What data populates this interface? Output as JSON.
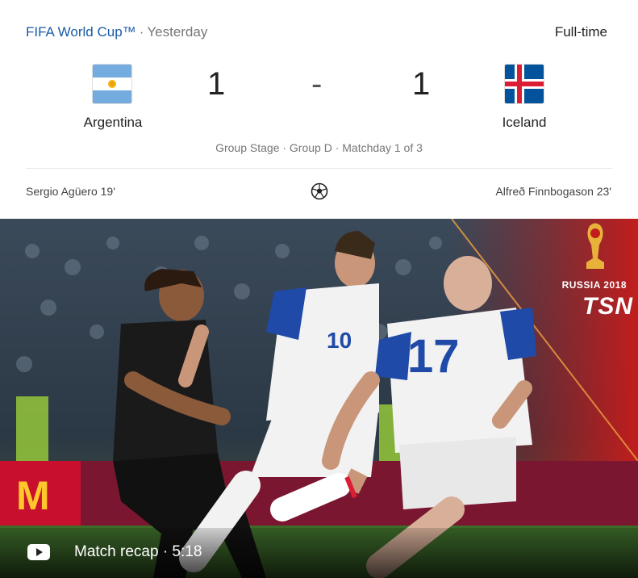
{
  "header": {
    "competition": "FIFA World Cup™",
    "separator": "·",
    "date": "Yesterday",
    "status": "Full-time"
  },
  "match": {
    "home": {
      "name": "Argentina",
      "score": "1",
      "flag_icon": "argentina-flag-icon"
    },
    "away": {
      "name": "Iceland",
      "score": "1",
      "flag_icon": "iceland-flag-icon"
    },
    "dash": "-",
    "stage": "Group Stage · Group D · Matchday 1 of 3"
  },
  "scorers": {
    "home": "Sergio Agüero 19'",
    "away": "Alfreð Finnbogason 23'",
    "icon": "soccer-ball-icon"
  },
  "video": {
    "label": "Match recap · 5:18",
    "icon": "play-icon",
    "branding": {
      "event": "RUSSIA 2018",
      "broadcaster": "TSN"
    }
  },
  "colors": {
    "link": "#1a5ba6",
    "muted": "#777777",
    "argentina_blue": "#74acdf",
    "iceland_blue": "#02529c",
    "iceland_red": "#dc1e35"
  }
}
